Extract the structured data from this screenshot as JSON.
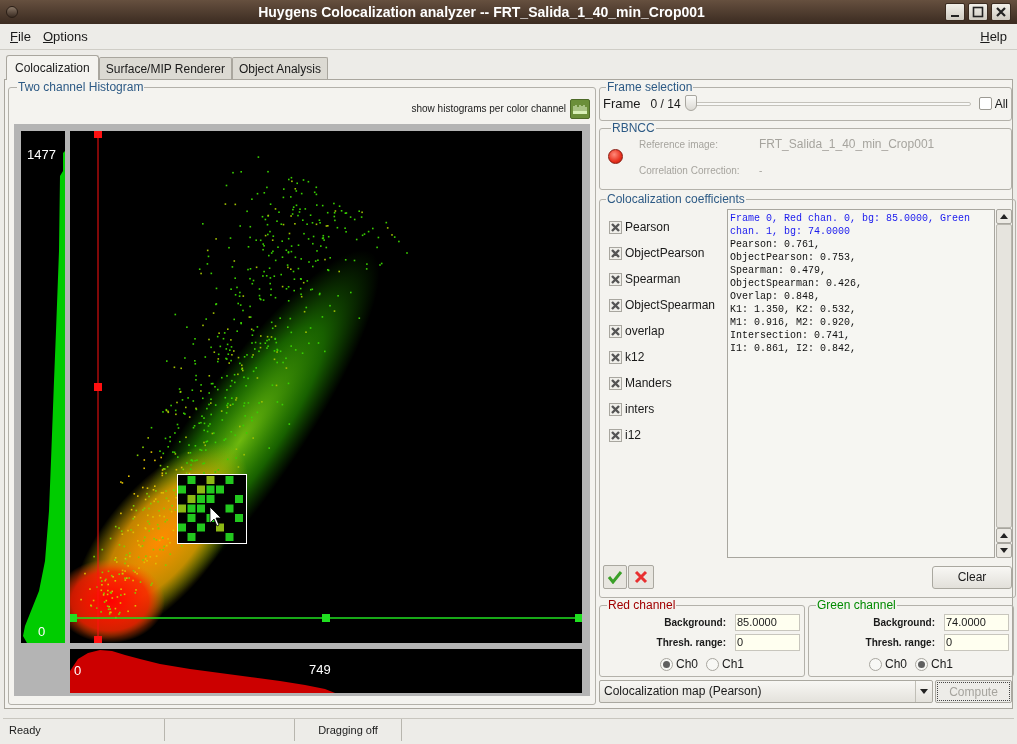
{
  "window": {
    "title": "Huygens Colocalization analyzer -- FRT_Salida_1_40_min_Crop001"
  },
  "menu": {
    "left": [
      "File",
      "Options"
    ],
    "right": [
      "Help"
    ]
  },
  "tabs": [
    {
      "label": "Colocalization",
      "selected": true
    },
    {
      "label": "Surface/MIP Renderer",
      "selected": false
    },
    {
      "label": "Object Analysis",
      "selected": false
    }
  ],
  "histogram": {
    "title": "Two channel Histogram",
    "toggle_label": "show histograms per color channel",
    "green_max": "1477",
    "green_min": "0",
    "red_min": "0",
    "red_max": "749"
  },
  "frame_selection": {
    "title": "Frame selection",
    "label": "Frame",
    "reading": "0 / 14",
    "level": 0,
    "all": {
      "label": "All",
      "checked": false
    }
  },
  "rbncc": {
    "title": "RBNCC",
    "disabled": true,
    "reference_label": "Reference image:",
    "reference_value": "FRT_Salida_1_40_min_Crop001",
    "correction_label": "Correlation Correction:",
    "correction_value": "-"
  },
  "coefficients": {
    "title": "Colocalization coefficients",
    "options": [
      {
        "label": "Pearson",
        "checked": true
      },
      {
        "label": "ObjectPearson",
        "checked": true
      },
      {
        "label": "Spearman",
        "checked": true
      },
      {
        "label": "ObjectSpearman",
        "checked": true
      },
      {
        "label": "overlap",
        "checked": true
      },
      {
        "label": "k12",
        "checked": true
      },
      {
        "label": "Manders",
        "checked": true
      },
      {
        "label": "inters",
        "checked": true
      },
      {
        "label": "i12",
        "checked": true
      }
    ],
    "output": [
      {
        "kind": "header",
        "text": "Frame 0, Red chan. 0, bg: 85.0000, Green chan. 1, bg: 74.0000"
      },
      {
        "kind": "line",
        "text": "Pearson: 0.761,"
      },
      {
        "kind": "line",
        "text": "ObjectPearson: 0.753,"
      },
      {
        "kind": "line",
        "text": "Spearman: 0.479,"
      },
      {
        "kind": "line",
        "text": "ObjectSpearman: 0.426,"
      },
      {
        "kind": "line",
        "text": "Overlap: 0.848,"
      },
      {
        "kind": "line",
        "text": "K1: 1.350, K2: 0.532,"
      },
      {
        "kind": "line",
        "text": "M1: 0.916, M2: 0.920,"
      },
      {
        "kind": "line",
        "text": "Intersection: 0.741,"
      },
      {
        "kind": "line",
        "text": "I1: 0.861, I2: 0.842,"
      }
    ],
    "clear": "Clear"
  },
  "channels": [
    {
      "title": "Red channel",
      "color": "#a00000",
      "background_label": "Background:",
      "background": "85.0000",
      "thresh_label": "Thresh. range:",
      "thresh": "0",
      "radios": [
        {
          "label": "Ch0",
          "selected": true
        },
        {
          "label": "Ch1",
          "selected": false
        }
      ]
    },
    {
      "title": "Green channel",
      "color": "#008a00",
      "background_label": "Background:",
      "background": "74.0000",
      "thresh_label": "Thresh. range:",
      "thresh": "0",
      "radios": [
        {
          "label": "Ch0",
          "selected": false
        },
        {
          "label": "Ch1",
          "selected": true
        }
      ]
    }
  ],
  "map": {
    "value": "Colocalization map (Pearson)"
  },
  "compute": {
    "label": "Compute",
    "disabled": true
  },
  "status_bar": [
    "Ready",
    "Dragging off"
  ]
}
